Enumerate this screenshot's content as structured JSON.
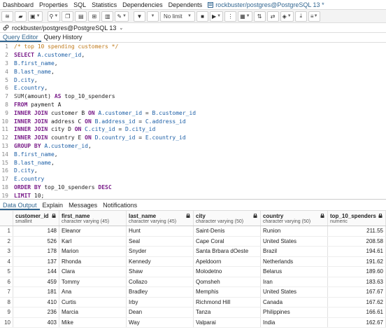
{
  "menubar": {
    "items": [
      "Dashboard",
      "Properties",
      "SQL",
      "Statistics",
      "Dependencies",
      "Dependents"
    ],
    "active_tab_title": "rockbuster/postgres@PostgreSQL 13 *"
  },
  "toolbar": {
    "limit_label": "No limit"
  },
  "connection": {
    "label": "rockbuster/postgres@PostgreSQL 13"
  },
  "editor_tabs": [
    "Query Editor",
    "Query History"
  ],
  "sql_lines": [
    [
      [
        "cm",
        "/* top 10 spending customers */"
      ]
    ],
    [
      [
        "kw",
        "SELECT "
      ],
      [
        "id",
        "A.customer_id"
      ],
      [
        "tl",
        ","
      ]
    ],
    [
      [
        "id",
        "B.first_name"
      ],
      [
        "tl",
        ","
      ]
    ],
    [
      [
        "id",
        "B.last_name"
      ],
      [
        "tl",
        ","
      ]
    ],
    [
      [
        "id",
        "D.city"
      ],
      [
        "tl",
        ","
      ]
    ],
    [
      [
        "id",
        "E.country"
      ],
      [
        "tl",
        ","
      ]
    ],
    [
      [
        "fn",
        "SUM"
      ],
      [
        "tl",
        "(amount) "
      ],
      [
        "kw",
        "AS "
      ],
      [
        "tl",
        "top_10_spenders"
      ]
    ],
    [
      [
        "kw",
        "FROM "
      ],
      [
        "tl",
        "payment A"
      ]
    ],
    [
      [
        "kw",
        "INNER JOIN "
      ],
      [
        "tl",
        "customer B "
      ],
      [
        "kw",
        "ON "
      ],
      [
        "id",
        "A.customer_id"
      ],
      [
        "tl",
        " = "
      ],
      [
        "id",
        "B.customer_id"
      ]
    ],
    [
      [
        "kw",
        "INNER JOIN "
      ],
      [
        "tl",
        "address C "
      ],
      [
        "kw",
        "ON "
      ],
      [
        "id",
        "B.address_id"
      ],
      [
        "tl",
        " = "
      ],
      [
        "id",
        "C.address_id"
      ]
    ],
    [
      [
        "kw",
        "INNER JOIN "
      ],
      [
        "tl",
        "city D "
      ],
      [
        "kw",
        "ON "
      ],
      [
        "id",
        "C.city_id"
      ],
      [
        "tl",
        " = "
      ],
      [
        "id",
        "D.city_id"
      ]
    ],
    [
      [
        "kw",
        "INNER JOIN "
      ],
      [
        "tl",
        "country E "
      ],
      [
        "kw",
        "ON "
      ],
      [
        "id",
        "D.country_id"
      ],
      [
        "tl",
        " = "
      ],
      [
        "id",
        "E.country_id"
      ]
    ],
    [
      [
        "kw",
        "GROUP BY "
      ],
      [
        "id",
        "A.customer_id"
      ],
      [
        "tl",
        ","
      ]
    ],
    [
      [
        "id",
        "B.first_name"
      ],
      [
        "tl",
        ","
      ]
    ],
    [
      [
        "id",
        "B.last_name"
      ],
      [
        "tl",
        ","
      ]
    ],
    [
      [
        "id",
        "D.city"
      ],
      [
        "tl",
        ","
      ]
    ],
    [
      [
        "id",
        "E.country"
      ]
    ],
    [
      [
        "kw",
        "ORDER BY "
      ],
      [
        "tl",
        "top_10_spenders "
      ],
      [
        "kw",
        "DESC"
      ]
    ],
    [
      [
        "kw",
        "LIMIT "
      ],
      [
        "tl",
        "10;"
      ]
    ]
  ],
  "output_tabs": [
    "Data Output",
    "Explain",
    "Messages",
    "Notifications"
  ],
  "grid": {
    "columns": [
      {
        "name": "customer_id",
        "type": "smallint"
      },
      {
        "name": "first_name",
        "type": "character varying (45)"
      },
      {
        "name": "last_name",
        "type": "character varying (45)"
      },
      {
        "name": "city",
        "type": "character varying (50)"
      },
      {
        "name": "country",
        "type": "character varying (50)"
      },
      {
        "name": "top_10_spenders",
        "type": "numeric"
      }
    ],
    "rows": [
      [
        "1",
        "148",
        "Eleanor",
        "Hunt",
        "Saint-Denis",
        "Runion",
        "211.55"
      ],
      [
        "2",
        "526",
        "Karl",
        "Seal",
        "Cape Coral",
        "United States",
        "208.58"
      ],
      [
        "3",
        "178",
        "Marion",
        "Snyder",
        "Santa Brbara dOeste",
        "Brazil",
        "194.61"
      ],
      [
        "4",
        "137",
        "Rhonda",
        "Kennedy",
        "Apeldoorn",
        "Netherlands",
        "191.62"
      ],
      [
        "5",
        "144",
        "Clara",
        "Shaw",
        "Molodetno",
        "Belarus",
        "189.60"
      ],
      [
        "6",
        "459",
        "Tommy",
        "Collazo",
        "Qomsheh",
        "Iran",
        "183.63"
      ],
      [
        "7",
        "181",
        "Ana",
        "Bradley",
        "Memphis",
        "United States",
        "167.67"
      ],
      [
        "8",
        "410",
        "Curtis",
        "Irby",
        "Richmond Hill",
        "Canada",
        "167.62"
      ],
      [
        "9",
        "236",
        "Marcia",
        "Dean",
        "Tanza",
        "Philippines",
        "166.61"
      ],
      [
        "10",
        "403",
        "Mike",
        "Way",
        "Valparai",
        "India",
        "162.67"
      ]
    ]
  },
  "colors": {
    "accent": "#326690",
    "keyword": "#7a1d8a",
    "identifier": "#1d5fa6",
    "comment": "#c07a1a"
  }
}
